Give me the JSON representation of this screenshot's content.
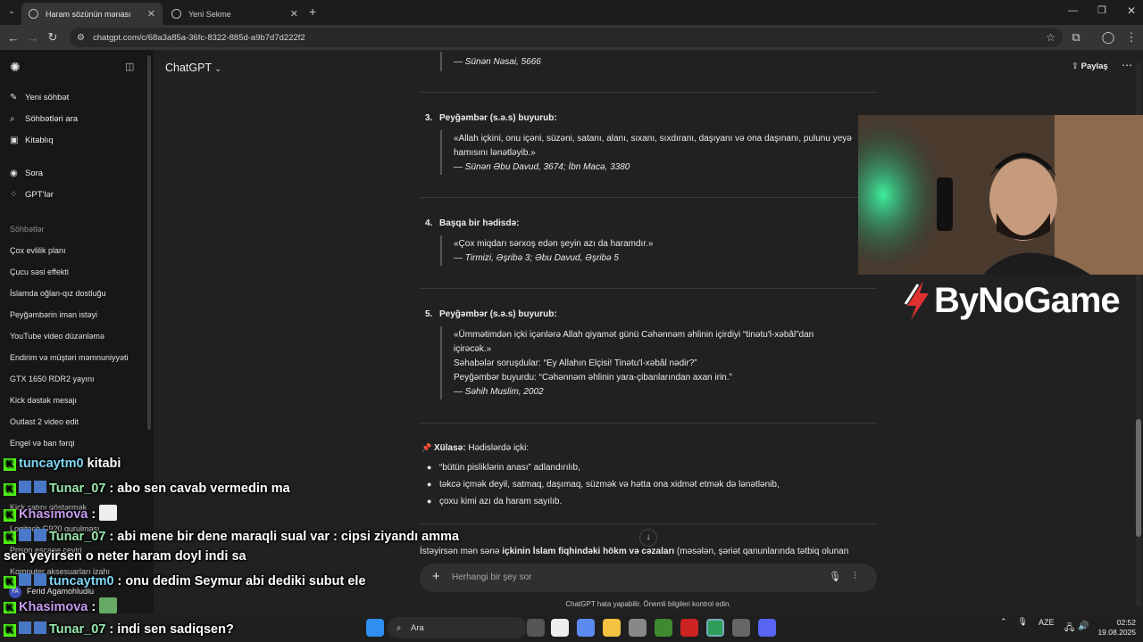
{
  "browser": {
    "tabs": [
      {
        "label": "Haram sözünün mənası",
        "active": true
      },
      {
        "label": "Yeni Sekme",
        "active": false
      }
    ],
    "new_tab": "+",
    "url": "chatgpt.com/c/68a3a85a-36fc-8322-885d-a9b7d7d222f2"
  },
  "sidebar": {
    "items": [
      {
        "label": "Yeni söhbət",
        "icon": "compose-icon"
      },
      {
        "label": "Söhbətləri ara",
        "icon": "search-icon"
      },
      {
        "label": "Kitablıq",
        "icon": "library-icon"
      },
      {
        "label": "Sora",
        "icon": "play-icon"
      },
      {
        "label": "GPT'lər",
        "icon": "grid-icon"
      }
    ],
    "section_title": "Söhbətlər",
    "conversations": [
      "Çox evlilik planı",
      "Çucu səsi effekti",
      "İslamda oğlan-qız dostluğu",
      "Peyğəmbərin iman istəyi",
      "YouTube video düzənləmə",
      "Endirim və müştəri məmnuniyyəti",
      "GTX 1650 RDR2 yayını",
      "Kick dəstək mesajı",
      "Outlast 2 video edit",
      "Engel və ban fərqi"
    ],
    "hidden_conversations": [
      "Kick çatını göstərmək",
      "Logitech G920 qurulması",
      "Prison escape çeviri",
      "Komputer aksesuarları izahı"
    ],
    "user": {
      "initials": "FA",
      "name": "Ferid Agamohludlu"
    }
  },
  "header": {
    "model": "ChatGPT",
    "share": "Paylaş"
  },
  "content": {
    "top_source": "— Sünən Nəsai, 5666",
    "hadiths": [
      {
        "num": "3.",
        "title": "Peyğəmbər (s.ə.s) buyurub:",
        "lines": [
          "«Allah içkini, onu içəni, süzəni, satanı, alanı, sıxanı, sıxdıranı, daşıyanı və ona daşınanı, pulunu yeyə",
          "hamısını lənətləyib.»"
        ],
        "source": "— Sünən Əbu Davud, 3674; İbn Macə, 3380"
      },
      {
        "num": "4.",
        "title": "Başqa bir hədisdə:",
        "lines": [
          "«Çox miqdarı sərxoş edən şeyin azı da haramdır.»"
        ],
        "source": "— Tirmizi, Əşribə 3; Əbu Davud, Əşribə 5"
      },
      {
        "num": "5.",
        "title": "Peyğəmbər (s.ə.s) buyurub:",
        "lines": [
          "«Ümmətimdən içki içənlərə Allah qiyamət günü Cəhənnəm əhlinin içirdiyi “tinətu'l-xəbâl”dan",
          "içirəcək.»",
          "Səhabələr soruşdular: “Ey Allahın Elçisi! Tinətu'l-xəbâl nədir?”",
          "Peyğəmbər buyurdu: “Cəhənnəm əhlinin yara-çibanlarından axan irin.”"
        ],
        "source": "— Səhih Muslim, 2002"
      }
    ],
    "summary_pin": "📌",
    "summary_label": "Xülasə:",
    "summary_text": "Hədislərdə içki:",
    "bullets": [
      "“bütün pisliklərin anası” adlandırılıb,",
      "təkcə içmək deyil, satmaq, daşımaq, süzmək və hətta ona xidmət etmək də lənətlənib,",
      "çoxu kimi azı da haram sayılıb."
    ],
    "cut_line_pre": "İstəyirsən mən sənə ",
    "cut_line_bold": "içkinin İslam fiqhindəki hökm və cəzaları",
    "cut_line_post": " (məsələn, şəriət qanunlarında tətbiq olunan"
  },
  "composer": {
    "placeholder": "Herhangi bir şey sor",
    "disclaimer": "ChatGPT hata yapabilir. Önemli bilgileri kontrol edin."
  },
  "overlay": {
    "logo": "ByNoGame",
    "chat": [
      {
        "user": "tuncaytm0",
        "msg": " kitabi",
        "badge": true,
        "color": "un"
      },
      {
        "user": "Tunar_07",
        "msg": " : abo sen cavab vermedin ma",
        "badge": true,
        "color": "un2"
      },
      {
        "user": "Khasimova",
        "msg": " :",
        "badge": false,
        "color": "un3",
        "emote": true
      },
      {
        "user": "Tunar_07",
        "msg": " : abi mene bir dene maraqli sual var : cipsi ziyandı amma",
        "badge": true,
        "color": "un2"
      },
      {
        "user": "",
        "msg": "sen yeyirsen o neter haram doyl indi sa",
        "badge": false,
        "color": "un"
      },
      {
        "user": "tuncaytm0",
        "msg": " : onu dedim Seymur abi dediki subut ele",
        "badge": true,
        "color": "un"
      },
      {
        "user": "Khasimova",
        "msg": " :",
        "badge": false,
        "color": "un3",
        "emote": true
      },
      {
        "user": "Tunar_07",
        "msg": " : indi sen sadiqsen?",
        "badge": true,
        "color": "un2"
      }
    ]
  },
  "taskbar": {
    "search": "Ara",
    "lang": "AZE",
    "time": "02:52",
    "date": "19.08.2025"
  }
}
